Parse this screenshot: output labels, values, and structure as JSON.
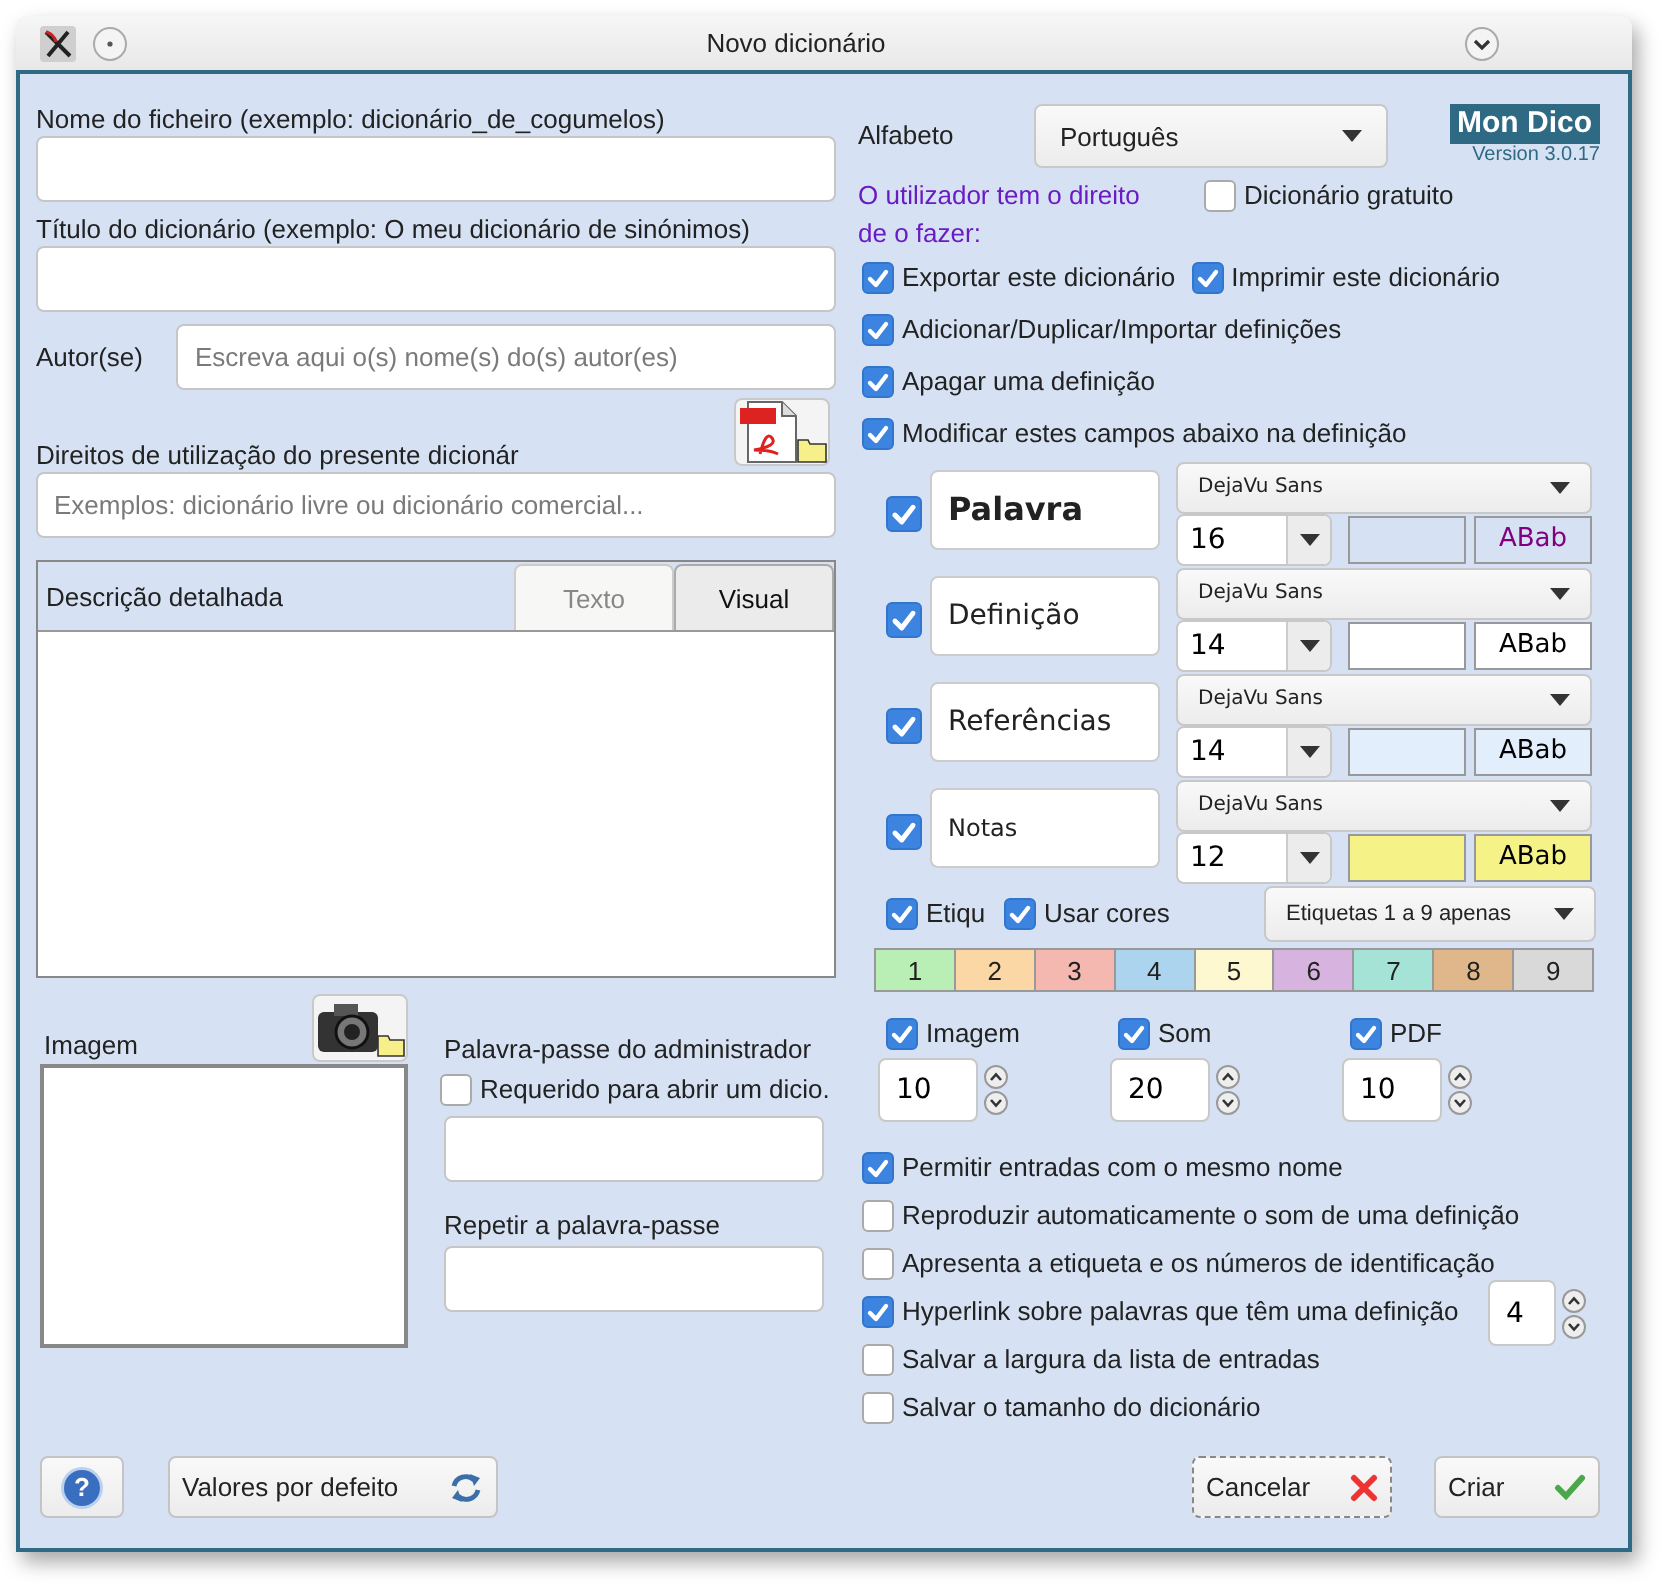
{
  "window": {
    "title": "Novo dicionário"
  },
  "file_name": {
    "label": "Nome do ficheiro (exemplo: dicionário_de_cogumelos)"
  },
  "dict_title": {
    "label": "Título do dicionário (exemplo: O meu dicionário de sinónimos)"
  },
  "author": {
    "label": "Autor(se)",
    "placeholder": "Escreva aqui o(s) nome(s) do(s) autor(es)"
  },
  "rights": {
    "label": "Direitos de utilização do presente dicionár",
    "placeholder": "Exemplos: dicionário livre ou dicionário comercial..."
  },
  "description": {
    "label": "Descrição detalhada",
    "tabs": [
      {
        "label": "Texto",
        "selected": false
      },
      {
        "label": "Visual",
        "selected": true
      }
    ]
  },
  "image": {
    "label": "Imagem"
  },
  "admin_password": {
    "label": "Palavra-passe do administrador",
    "required": {
      "label": "Requerido para abrir um dicio.",
      "checked": false
    },
    "repeat_label": "Repetir a palavra-passe"
  },
  "alphabet": {
    "label": "Alfabeto",
    "value": "Português"
  },
  "logo": {
    "text": "Mon Dico",
    "version": "Version 3.0.17"
  },
  "rights_heading": "O utilizador tem o direito de o fazer:",
  "free_dictionary": {
    "label": "Dicionário gratuito",
    "checked": false
  },
  "permissions": [
    {
      "label": "Exportar este dicionário",
      "checked": true
    },
    {
      "label": "Imprimir este dicionário",
      "checked": true
    },
    {
      "label": "Adicionar/Duplicar/Importar definições",
      "checked": true
    },
    {
      "label": "Apagar uma definição",
      "checked": true
    },
    {
      "label": "Modificar estes campos abaixo na definição",
      "checked": true
    }
  ],
  "fields": [
    {
      "label": "Palavra",
      "checked": true,
      "bold": true,
      "font": "DejaVu Sans",
      "size": "16",
      "color": "#d6e2f3",
      "sample": {
        "text": "ABab",
        "color": "#800080"
      }
    },
    {
      "label": "Definição",
      "checked": true,
      "bold": false,
      "font": "DejaVu Sans",
      "size": "14",
      "color": "#ffffff",
      "sample": {
        "text": "ABab",
        "color": "#000000"
      }
    },
    {
      "label": "Referências",
      "checked": true,
      "bold": false,
      "font": "DejaVu Sans",
      "size": "14",
      "color": "#e3eefd",
      "sample": {
        "text": "ABab",
        "color": "#000000"
      }
    },
    {
      "label": "Notas",
      "checked": true,
      "bold": false,
      "font": "DejaVu Sans",
      "size": "12",
      "color": "#f5f388",
      "sample": {
        "text": "ABab",
        "color": "#000000"
      }
    }
  ],
  "tags": {
    "show": {
      "label": "Etiqu",
      "checked": true
    },
    "use_colors": {
      "label": "Usar cores",
      "checked": true
    },
    "filter": "Etiquetas 1 a 9 apenas",
    "items": [
      {
        "label": "1",
        "color": "#b9efb5"
      },
      {
        "label": "2",
        "color": "#fad7a4"
      },
      {
        "label": "3",
        "color": "#f5b8b0"
      },
      {
        "label": "4",
        "color": "#add4ee"
      },
      {
        "label": "5",
        "color": "#fdf8cf"
      },
      {
        "label": "6",
        "color": "#d7b4e0"
      },
      {
        "label": "7",
        "color": "#a5e3d6"
      },
      {
        "label": "8",
        "color": "#dfb78a"
      },
      {
        "label": "9",
        "color": "#d9d9d9"
      }
    ]
  },
  "media": [
    {
      "label": "Imagem",
      "checked": true,
      "value": "10"
    },
    {
      "label": "Som",
      "checked": true,
      "value": "20"
    },
    {
      "label": "PDF",
      "checked": true,
      "value": "10"
    }
  ],
  "options": [
    {
      "label": "Permitir entradas com o mesmo nome",
      "checked": true
    },
    {
      "label": "Reproduzir automaticamente o som de uma definição",
      "checked": false
    },
    {
      "label": "Apresenta a etiqueta e os números de identificação",
      "checked": false
    },
    {
      "label": "Hyperlink sobre palavras que têm uma definição",
      "checked": true,
      "value": "4"
    },
    {
      "label": "Salvar a largura da lista de entradas",
      "checked": false
    },
    {
      "label": "Salvar o tamanho do dicionário",
      "checked": false
    }
  ],
  "buttons": {
    "help": "?",
    "defaults": "Valores por defeito",
    "cancel": "Cancelar",
    "create": "Criar"
  }
}
